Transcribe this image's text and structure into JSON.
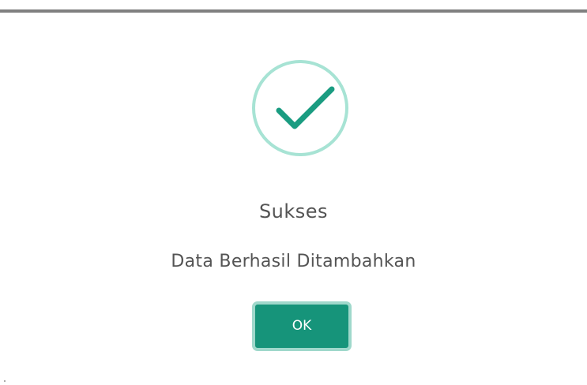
{
  "dialog": {
    "icon": "checkmark-icon",
    "title": "Sukses",
    "message": "Data Berhasil Ditambahkan",
    "confirm_label": "OK"
  },
  "colors": {
    "icon_ring": "#a7e3d4",
    "checkmark": "#1a9c81",
    "button_bg": "#16947a",
    "button_ring": "#9fd8cb",
    "text": "#545454"
  }
}
